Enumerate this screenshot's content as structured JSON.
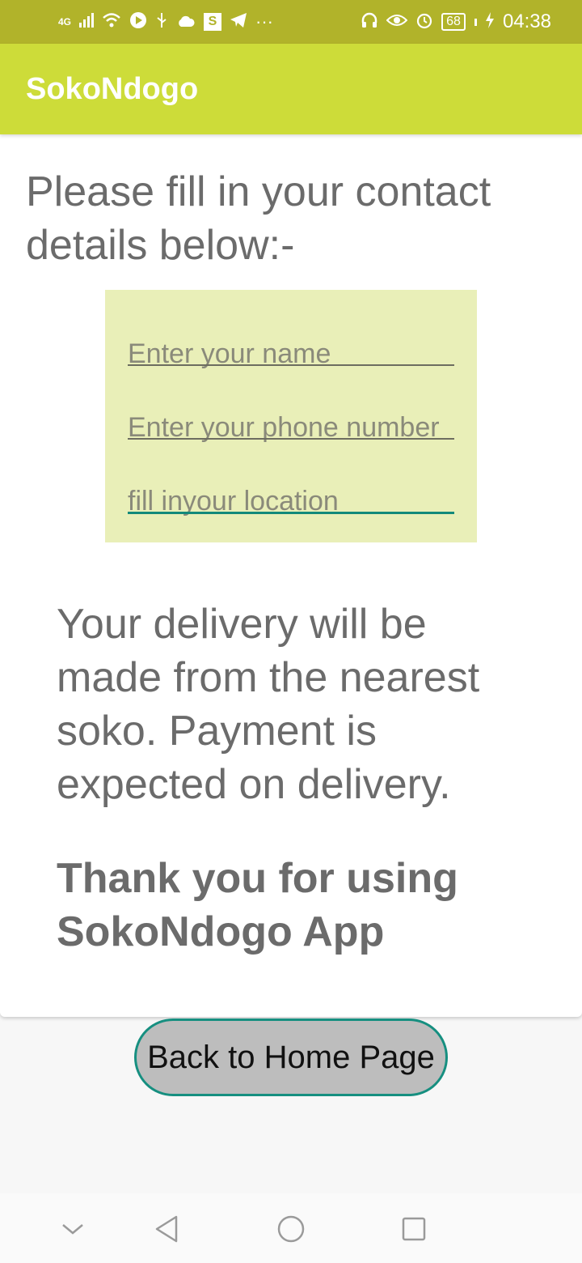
{
  "status_bar": {
    "left_icons": [
      "signal-4g-icon",
      "wifi-icon",
      "play-icon",
      "usb-icon",
      "cloud-icon",
      "s-app-icon",
      "telegram-icon",
      "more-dots-icon"
    ],
    "signal_label": "4G",
    "s_label": "S",
    "dots": "···",
    "battery": "68",
    "time": "04:38"
  },
  "app_bar": {
    "title": "SokoNdogo",
    "color": "#cddc39"
  },
  "content": {
    "instructions": "Please fill in your contact details below:-",
    "form": {
      "name_placeholder": "Enter your name",
      "phone_placeholder": "Enter your phone number",
      "location_placeholder": "fill inyour location"
    },
    "delivery_note": "Your delivery will be made from the nearest soko. Payment is expected on delivery.",
    "thanks": "Thank you for using SokoNdogo App"
  },
  "button": {
    "label": "Back to Home Page"
  },
  "nav_bar": {
    "icons": [
      "chevron-down-icon",
      "back-triangle-icon",
      "home-circle-icon",
      "recents-square-icon"
    ]
  },
  "colors": {
    "status_bar": "#b1b32a",
    "form_panel": "#e9efb8",
    "accent": "#138a7a",
    "text_gray": "#6b6b6b"
  }
}
